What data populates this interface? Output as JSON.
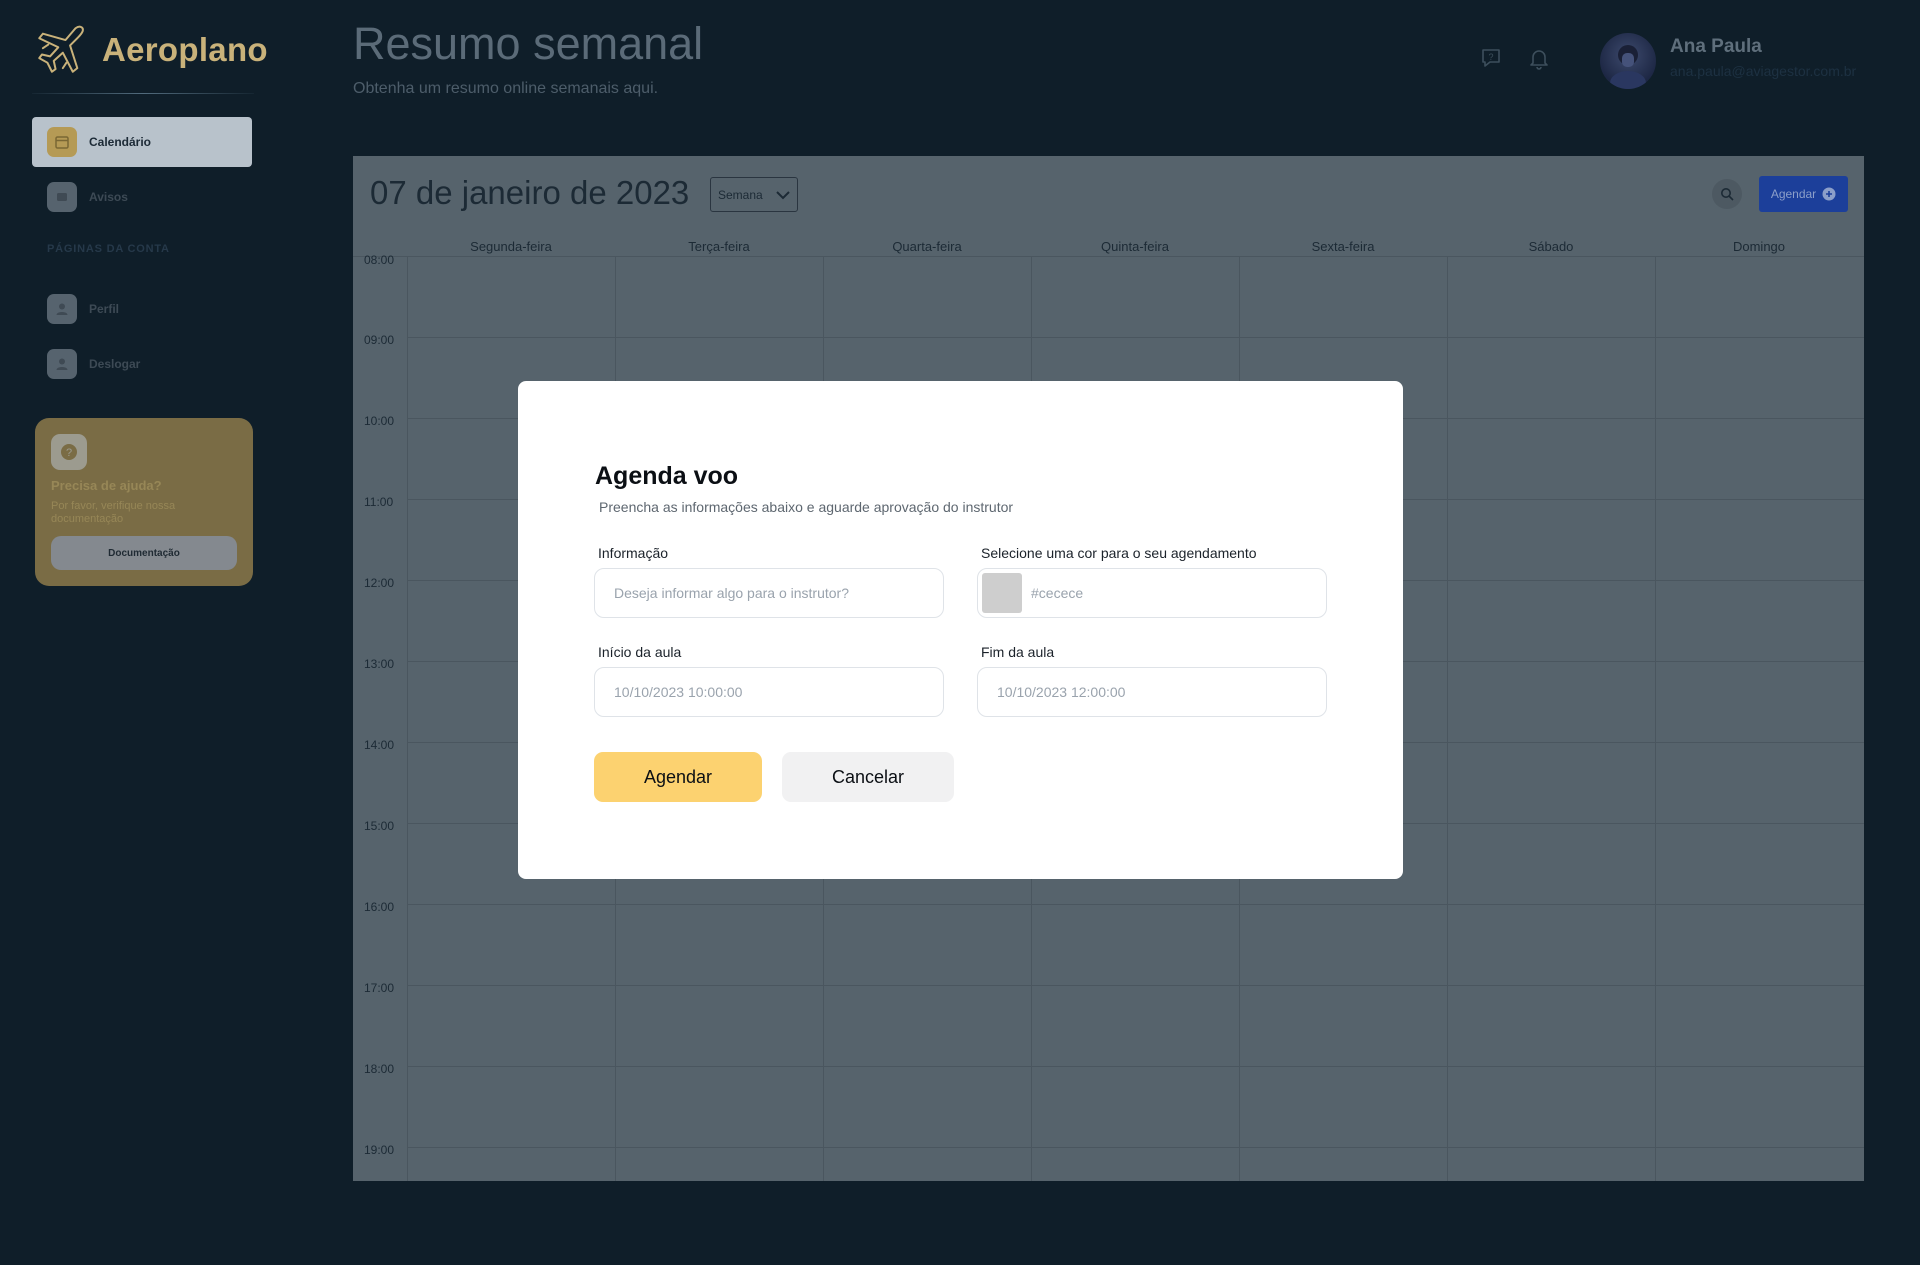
{
  "app": {
    "name": "Aeroplano"
  },
  "sidebar": {
    "items": [
      {
        "label": "Calendário",
        "icon": "calendar-icon",
        "active": true
      },
      {
        "label": "Avisos",
        "icon": "notice-icon",
        "active": false
      }
    ],
    "section_title": "PÁGINAS DA CONTA",
    "account_items": [
      {
        "label": "Perfil",
        "icon": "user-icon"
      },
      {
        "label": "Deslogar",
        "icon": "user-icon"
      }
    ],
    "help": {
      "title": "Precisa de ajuda?",
      "text": "Por favor, verifique nossa documentação",
      "button": "Documentação"
    }
  },
  "header": {
    "title": "Resumo semanal",
    "subtitle": "Obtenha um resumo online semanais aqui.",
    "user": {
      "name": "Ana Paula",
      "email": "ana.paula@aviagestor.com.br"
    }
  },
  "calendar": {
    "date": "07 de janeiro de 2023",
    "view": "Semana",
    "add_button": "Agendar",
    "days": [
      "Segunda-feira",
      "Terça-feira",
      "Quarta-feira",
      "Quinta-feira",
      "Sexta-feira",
      "Sábado",
      "Domingo"
    ],
    "hours": [
      "08:00",
      "09:00",
      "10:00",
      "11:00",
      "12:00",
      "13:00",
      "14:00",
      "15:00",
      "16:00",
      "17:00",
      "18:00",
      "19:00"
    ]
  },
  "modal": {
    "title": "Agenda voo",
    "subtitle": "Preencha as informações abaixo e aguarde aprovação do instrutor",
    "info_label": "Informação",
    "info_placeholder": "Deseja informar algo para o instrutor?",
    "color_label": "Selecione uma cor para o seu agendamento",
    "color_value": "#cecece",
    "start_label": "Início da aula",
    "start_value": "10/10/2023 10:00:00",
    "end_label": "Fim da aula",
    "end_value": "10/10/2023 12:00:00",
    "submit": "Agendar",
    "cancel": "Cancelar"
  },
  "colors": {
    "background": "#0f1e29",
    "accent_yellow": "#fcd270",
    "accent_blue": "#1c3f9a",
    "swatch": "#cecece"
  }
}
